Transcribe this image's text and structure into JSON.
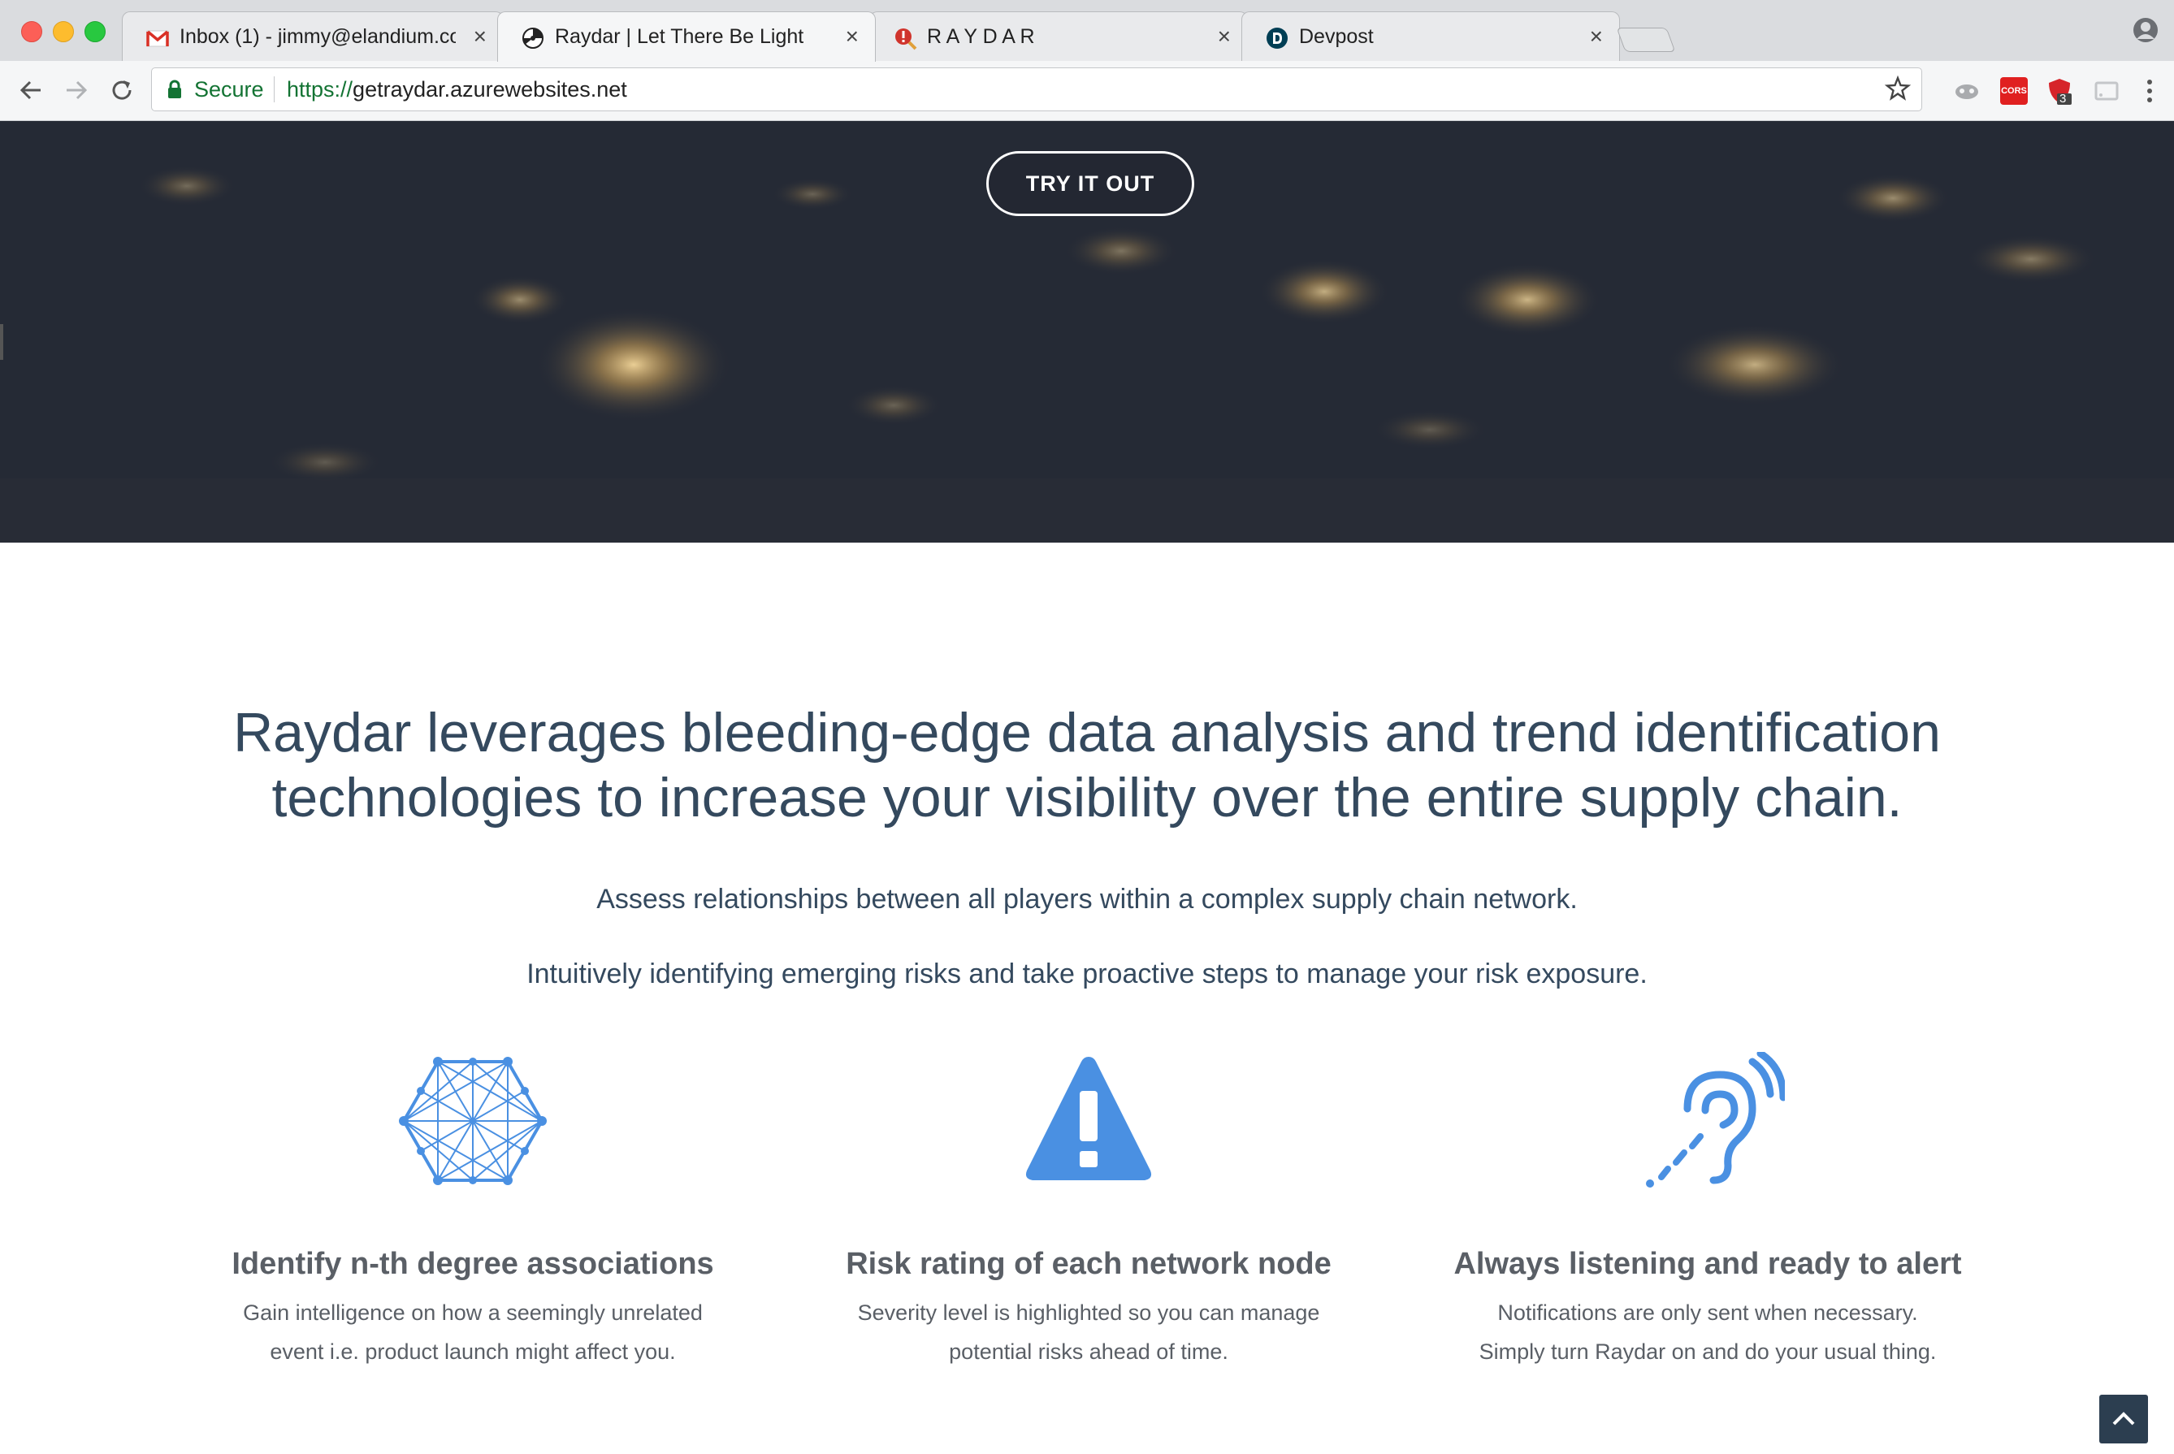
{
  "browser": {
    "tabs": [
      {
        "title": "Inbox (1) - jimmy@elandium.co",
        "icon": "gmail-icon",
        "active": false
      },
      {
        "title": "Raydar | Let There Be Light",
        "icon": "raydar-favicon",
        "active": true
      },
      {
        "title": "R A Y D A R",
        "icon": "raydar-alert-favicon",
        "active": false
      },
      {
        "title": "Devpost",
        "icon": "devpost-icon",
        "active": false
      }
    ],
    "close_glyph": "×",
    "security_label": "Secure",
    "url_scheme": "https://",
    "url_host": "getraydar.azurewebsites.net",
    "extensions": [
      "mask-extension-icon",
      "cors-extension-icon",
      "ublock-extension-icon",
      "cast-extension-icon"
    ],
    "extension_badge": "3",
    "cors_label": "CORS"
  },
  "hero": {
    "cta_label": "TRY IT OUT"
  },
  "intro": {
    "headline": "Raydar leverages bleeding-edge data analysis and trend identification technologies to increase your visibility over the entire supply chain.",
    "line1": "Assess relationships between all players within a complex supply chain network.",
    "line2": "Intuitively identifying emerging risks and take proactive steps to manage your risk exposure."
  },
  "features": [
    {
      "icon": "network-hexagon-icon",
      "title": "Identify n-th degree associations",
      "desc_line1": "Gain intelligence on how a seemingly unrelated",
      "desc_line2": "event i.e. product launch might affect you."
    },
    {
      "icon": "warning-triangle-icon",
      "title": "Risk rating of each network node",
      "desc_line1": "Severity level is highlighted so you can manage",
      "desc_line2": "potential risks ahead of time."
    },
    {
      "icon": "listening-ear-icon",
      "title": "Always listening and ready to alert",
      "desc_line1": "Notifications are only sent when necessary.",
      "desc_line2": "Simply turn Raydar on and do your usual thing."
    }
  ],
  "colors": {
    "accent_blue": "#4a90e2",
    "text_dark": "#34495e",
    "text_gray": "#5a5f66",
    "scroll_top_bg": "#2c3e50"
  }
}
